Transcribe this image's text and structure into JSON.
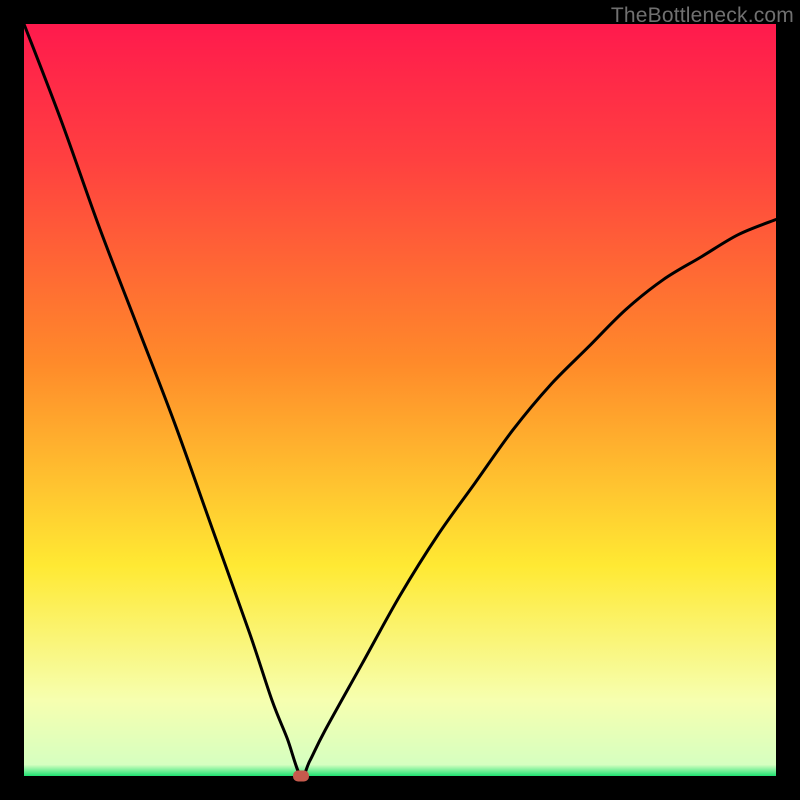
{
  "watermark": "TheBottleneck.com",
  "colors": {
    "top": "#ff1a4d",
    "mid_red": "#ff4040",
    "orange": "#ff8a2a",
    "yellow": "#ffe933",
    "pale": "#f6ffb0",
    "green": "#1fe071",
    "margin": "#000000",
    "curve": "#000000",
    "marker": "#c65a4d"
  },
  "frame": {
    "inner_width": 752,
    "inner_height": 752,
    "margin": 24
  },
  "chart_data": {
    "type": "line",
    "title": "",
    "xlabel": "",
    "ylabel": "",
    "xlim": [
      0,
      100
    ],
    "ylim": [
      0,
      100
    ],
    "grid": false,
    "legend": null,
    "note": "No axis ticks or labels are rendered in the image; x and y are normalized 0–100 from visual estimation. Curve is a V-shaped bottleneck profile with minimum near x≈37. Left branch runs from top-left corner down to the minimum; right branch rises from the minimum toward the right edge at roughly y≈74.",
    "series": [
      {
        "name": "bottleneck-curve",
        "x": [
          0,
          5,
          10,
          15,
          20,
          25,
          30,
          33,
          35,
          36.8,
          38,
          40,
          45,
          50,
          55,
          60,
          65,
          70,
          75,
          80,
          85,
          90,
          95,
          100
        ],
        "y": [
          100,
          87,
          73,
          60,
          47,
          33,
          19,
          10,
          5,
          0,
          2,
          6,
          15,
          24,
          32,
          39,
          46,
          52,
          57,
          62,
          66,
          69,
          72,
          74
        ]
      }
    ],
    "marker": {
      "x": 36.8,
      "y": 0,
      "label": ""
    },
    "background_gradient": {
      "stops": [
        {
          "offset": 0.0,
          "color": "#ff1a4d"
        },
        {
          "offset": 0.18,
          "color": "#ff4040"
        },
        {
          "offset": 0.45,
          "color": "#ff8a2a"
        },
        {
          "offset": 0.72,
          "color": "#ffe933"
        },
        {
          "offset": 0.9,
          "color": "#f6ffb0"
        },
        {
          "offset": 0.985,
          "color": "#d6ffc0"
        },
        {
          "offset": 1.0,
          "color": "#1fe071"
        }
      ]
    }
  }
}
